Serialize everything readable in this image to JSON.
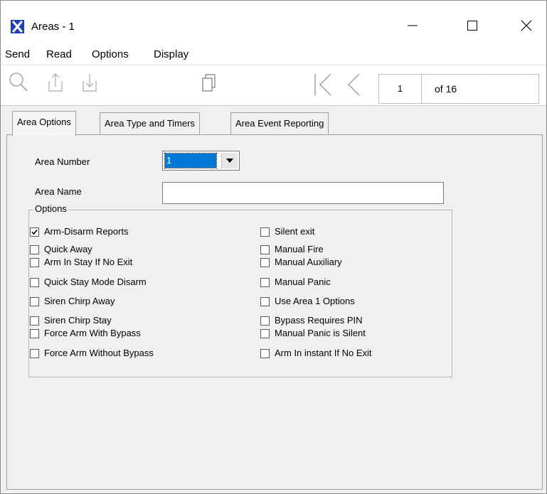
{
  "window": {
    "title": "Areas - 1",
    "app_icon": "x-logo-icon"
  },
  "menu": [
    "Send",
    "Read",
    "Options",
    "Display"
  ],
  "pager": {
    "current": "1",
    "of_label": "of 16"
  },
  "tabs": [
    "Area Options",
    "Area Type and Timers",
    "Area Event Reporting"
  ],
  "form": {
    "area_number_label": "Area Number",
    "area_number_value": "1",
    "area_name_label": "Area Name",
    "area_name_value": "",
    "options_legend": "Options"
  },
  "options_left": [
    {
      "label": "Arm-Disarm Reports",
      "checked": true
    },
    {
      "label": "Quick Away",
      "checked": false
    },
    {
      "label": "Arm In Stay If No Exit",
      "checked": false
    },
    {
      "label": "Quick Stay Mode Disarm",
      "checked": false
    },
    {
      "label": "Siren Chirp Away",
      "checked": false
    },
    {
      "label": "Siren Chirp Stay",
      "checked": false
    },
    {
      "label": "Force Arm With Bypass",
      "checked": false
    },
    {
      "label": "Force Arm Without Bypass",
      "checked": false
    }
  ],
  "options_right": [
    {
      "label": "Silent exit",
      "checked": false
    },
    {
      "label": "Manual Fire",
      "checked": false
    },
    {
      "label": "Manual Auxiliary",
      "checked": false
    },
    {
      "label": "Manual Panic",
      "checked": false
    },
    {
      "label": "Use Area 1 Options",
      "checked": false
    },
    {
      "label": "Bypass Requires PIN",
      "checked": false
    },
    {
      "label": "Manual Panic is Silent",
      "checked": false
    },
    {
      "label": "Arm In instant If No Exit",
      "checked": false
    }
  ],
  "colors": {
    "accent": "#0078d7",
    "app_icon": "#1d3fb8"
  }
}
